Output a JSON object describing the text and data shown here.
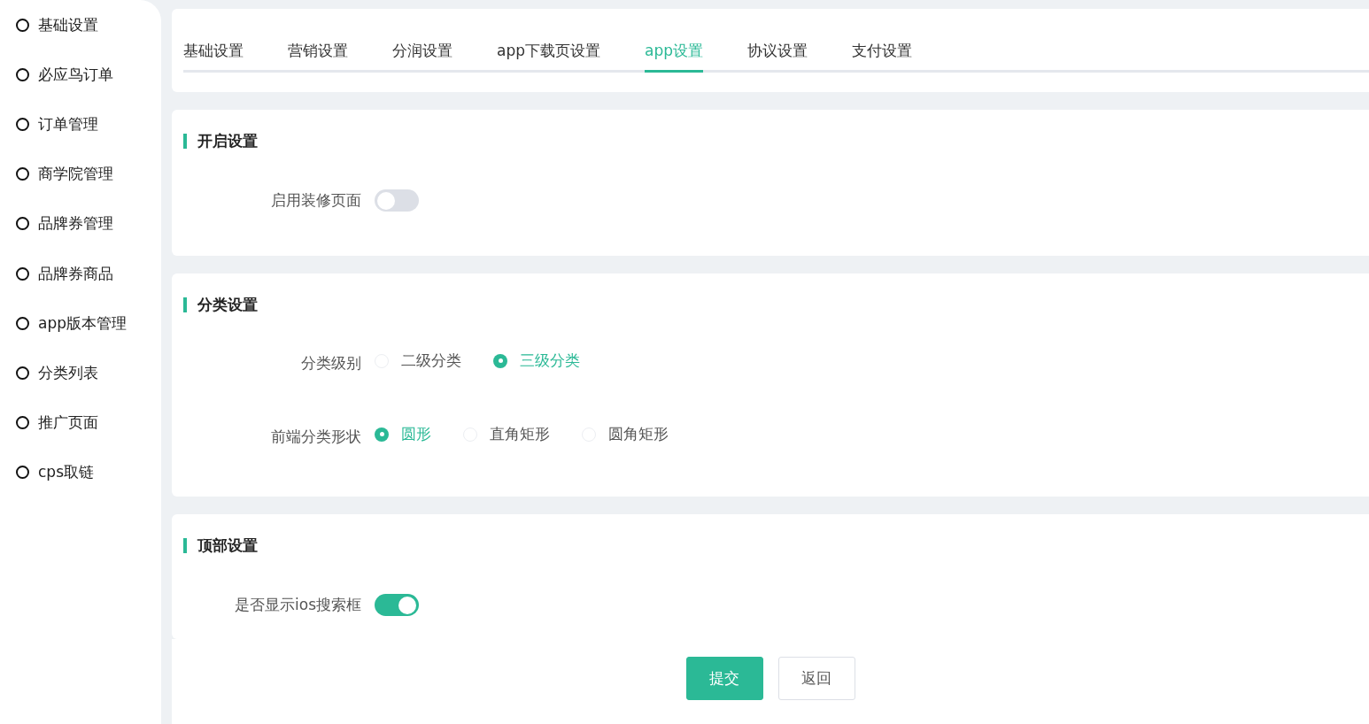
{
  "sidebar": {
    "items": [
      {
        "label": "基础设置"
      },
      {
        "label": "必应鸟订单"
      },
      {
        "label": "订单管理"
      },
      {
        "label": "商学院管理"
      },
      {
        "label": "品牌券管理"
      },
      {
        "label": "品牌券商品"
      },
      {
        "label": "app版本管理"
      },
      {
        "label": "分类列表"
      },
      {
        "label": "推广页面"
      },
      {
        "label": "cps取链"
      }
    ]
  },
  "tabs": [
    {
      "label": "基础设置",
      "selected": false
    },
    {
      "label": "营销设置",
      "selected": false
    },
    {
      "label": "分润设置",
      "selected": false
    },
    {
      "label": "app下载页设置",
      "selected": false
    },
    {
      "label": "app设置",
      "selected": true
    },
    {
      "label": "协议设置",
      "selected": false
    },
    {
      "label": "支付设置",
      "selected": false
    }
  ],
  "sections": [
    {
      "title": "开启设置",
      "rows": [
        {
          "kind": "toggle",
          "label": "启用装修页面",
          "on": false
        }
      ]
    },
    {
      "title": "分类设置",
      "rows": [
        {
          "kind": "radio",
          "label": "分类级别",
          "options": [
            {
              "label": "二级分类",
              "selected": false
            },
            {
              "label": "三级分类",
              "selected": true
            }
          ]
        },
        {
          "kind": "radio",
          "label": "前端分类形状",
          "options": [
            {
              "label": "圆形",
              "selected": true
            },
            {
              "label": "直角矩形",
              "selected": false
            },
            {
              "label": "圆角矩形",
              "selected": false
            }
          ]
        }
      ]
    },
    {
      "title": "顶部设置",
      "rows": [
        {
          "kind": "toggle",
          "label": "是否显示ios搜索框",
          "on": true
        }
      ]
    }
  ],
  "buttons": [
    {
      "label": "提交",
      "kind": "primary"
    },
    {
      "label": "返回",
      "kind": "default"
    }
  ]
}
